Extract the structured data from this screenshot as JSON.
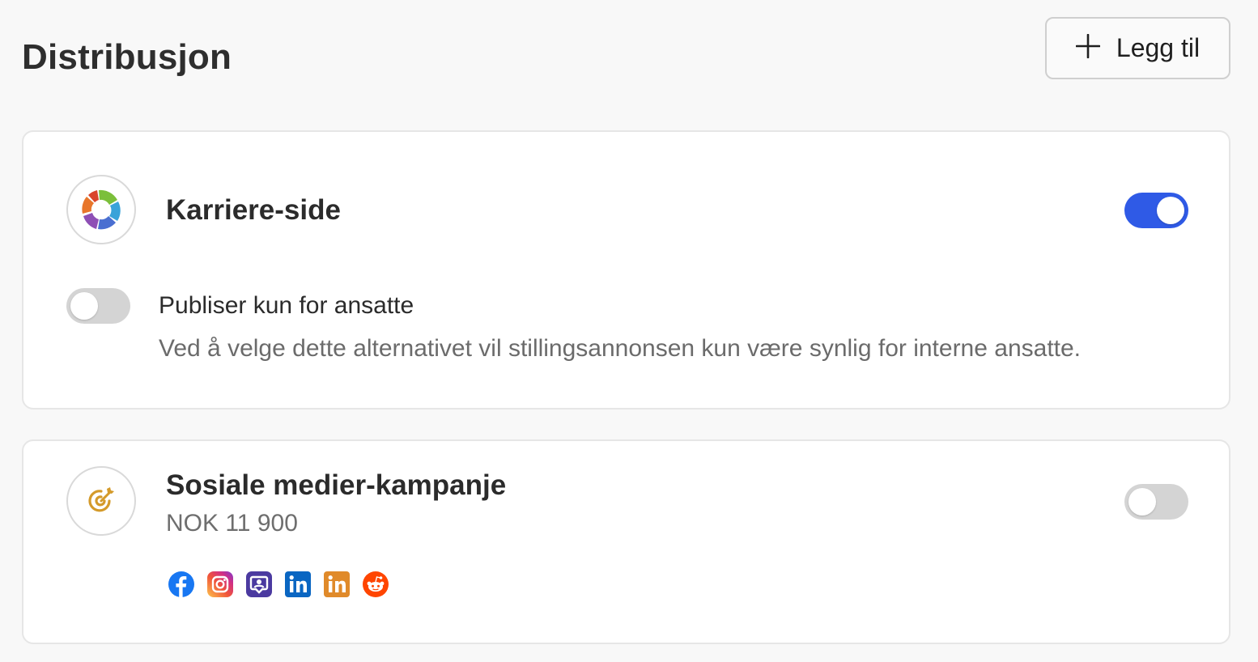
{
  "header": {
    "title": "Distribusjon",
    "add_button_label": "Legg til",
    "add_icon": "plus-icon"
  },
  "cards": [
    {
      "title": "Karriere-side",
      "logo_icon": "colorful-ring-logo",
      "enabled": true,
      "option": {
        "label": "Publiser kun for ansatte",
        "description": "Ved å velge dette alternativet vil stillingsannonsen kun være synlig for interne ansatte.",
        "enabled": false
      }
    },
    {
      "title": "Sosiale medier-kampanje",
      "price": "NOK 11 900",
      "logo_icon": "target-arrow-icon",
      "enabled": false,
      "channels": [
        "facebook-icon",
        "instagram-icon",
        "speech-bubble-person-icon",
        "linkedin-icon",
        "linkedin-orange-icon",
        "reddit-icon"
      ]
    }
  ],
  "colors": {
    "toggle_on": "#2f5ae6",
    "toggle_off": "#d4d4d4",
    "target_icon": "#d49a2a"
  }
}
